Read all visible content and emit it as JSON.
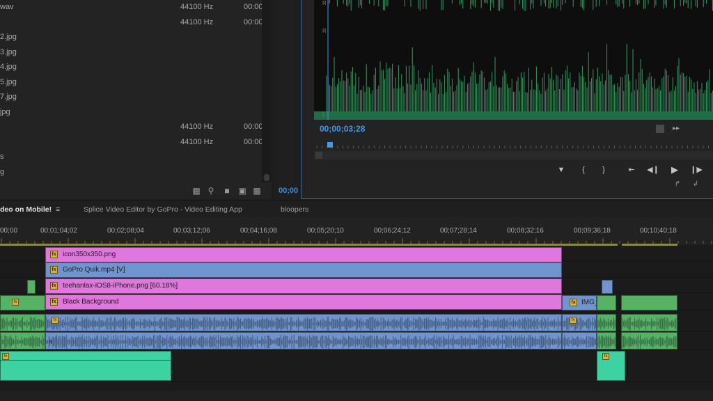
{
  "project": {
    "rows": [
      {
        "name": "wav",
        "rate": "44100 Hz",
        "duration": "00:00"
      },
      {
        "name": "",
        "rate": "44100 Hz",
        "duration": "00:00"
      },
      {
        "name": "2.jpg",
        "rate": "",
        "duration": ""
      },
      {
        "name": "3.jpg",
        "rate": "",
        "duration": ""
      },
      {
        "name": "4.jpg",
        "rate": "",
        "duration": ""
      },
      {
        "name": "5.jpg",
        "rate": "",
        "duration": ""
      },
      {
        "name": "7.jpg",
        "rate": "",
        "duration": ""
      },
      {
        "name": "jpg",
        "rate": "",
        "duration": ""
      },
      {
        "name": "",
        "rate": "44100 Hz",
        "duration": "00:00"
      },
      {
        "name": "",
        "rate": "44100 Hz",
        "duration": "00:00"
      },
      {
        "name": "s",
        "rate": "",
        "duration": ""
      },
      {
        "name": "g",
        "rate": "",
        "duration": ""
      }
    ],
    "footer_icons": [
      "list-view-icon",
      "search-icon",
      "new-bin-icon",
      "new-item-icon",
      "trash-icon"
    ]
  },
  "source": {
    "timecode": "00;00"
  },
  "program": {
    "channel_labels": [
      "R",
      "L",
      "R"
    ],
    "timecode": "00;00;03;28",
    "buttons": [
      {
        "name": "marker",
        "glyph": "▼"
      },
      {
        "name": "mark-in",
        "glyph": "{"
      },
      {
        "name": "mark-out",
        "glyph": "}"
      },
      {
        "name": "go-to-in",
        "glyph": "⇤"
      },
      {
        "name": "step-back",
        "glyph": "◀❙"
      },
      {
        "name": "play",
        "glyph": "▶"
      },
      {
        "name": "step-forward",
        "glyph": "❙▶"
      }
    ]
  },
  "tabs": [
    {
      "label": "deo on Mobile!",
      "active": true
    },
    {
      "label": "Splice Video Editor by GoPro - Video Editing App",
      "active": false
    },
    {
      "label": "bloopers",
      "active": false
    }
  ],
  "tab_menu_glyph": "≡",
  "timeline": {
    "ruler_labels": [
      "00;00",
      "00;01;04;02",
      "00;02;08;04",
      "00;03;12;06",
      "00;04;16;08",
      "00;05;20;10",
      "00;06;24;12",
      "00;07;28;14",
      "00;08;32;16",
      "00;09;36;18",
      "00;10;40;18"
    ],
    "clips": {
      "v4": "icon350x350.png",
      "v3": "GoPro Quik.mp4 [V]",
      "v2": "teehanlax-iOS8-iPhone.png [60.18%]",
      "v1": "Black Background",
      "v1_right": "IMG_"
    },
    "fx_glyph": "fx",
    "audio_glyph_l": "L",
    "audio_glyph_r": "R"
  },
  "colors": {
    "accent": "#3d9be8",
    "video_pink": "#df77dc",
    "video_blue": "#6f95cf",
    "audio_green": "#55b463",
    "audio_teal": "#3cd2a1",
    "waveform": "#2f9a66"
  }
}
